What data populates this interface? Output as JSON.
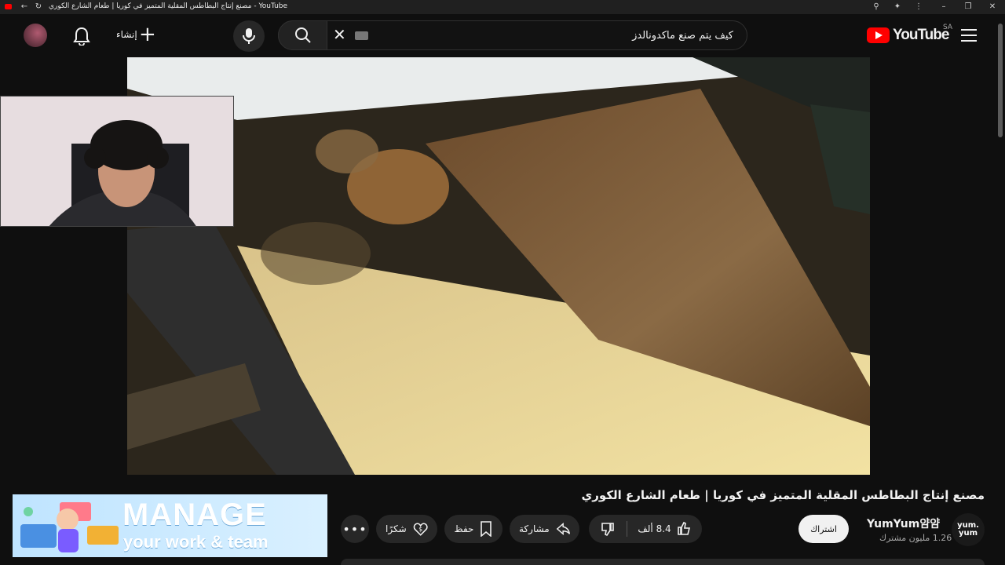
{
  "browser": {
    "tab_title": "مصنع إنتاج البطاطس المقلية المتميز في كوريا | طعام الشارع الكوري - YouTube"
  },
  "header": {
    "logo_text": "YouTube",
    "region": "SA",
    "search_query": "كيف يتم صنع ماكدونالدز",
    "create_label": "إنشاء"
  },
  "video": {
    "title": "مصنع إنتاج البطاطس المقلية المتميز في كوريا | طعام الشارع الكوري"
  },
  "channel": {
    "name": "YumYum얌얌",
    "subscribers": "1.26 مليون مشترك",
    "avatar_text": "yum.\nyum",
    "subscribe_label": "اشتراك"
  },
  "actions": {
    "likes": "8.4 ألف",
    "share": "مشاركة",
    "save": "حفظ",
    "thanks": "شكرًا"
  },
  "ad": {
    "line1": "MANAGE",
    "line2": "your work & team"
  },
  "colors": {
    "brand_red": "#ff0000",
    "background": "#0f0f0f"
  }
}
